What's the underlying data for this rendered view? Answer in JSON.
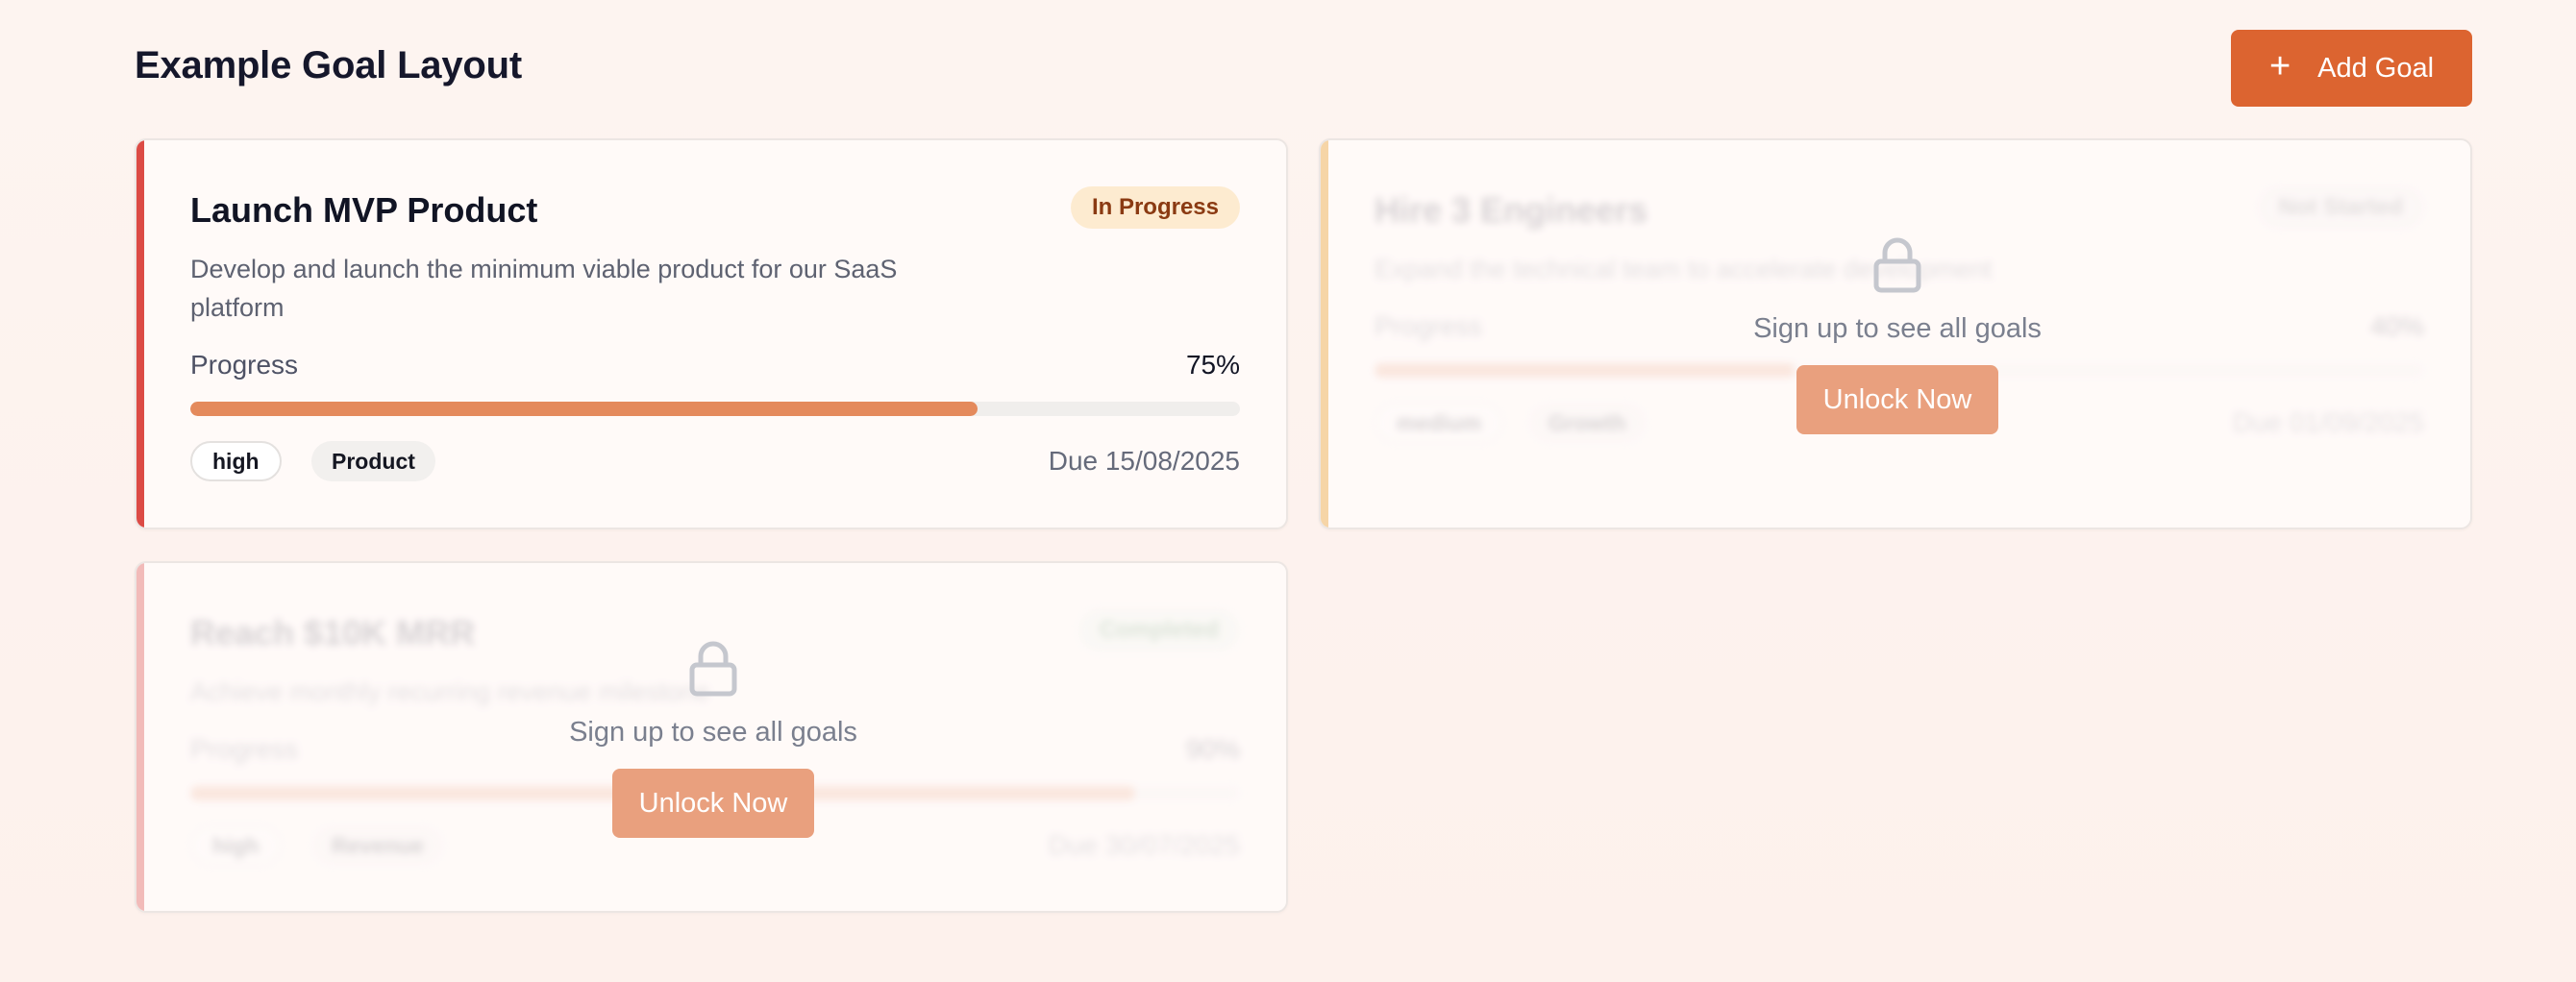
{
  "page": {
    "title": "Example Goal Layout",
    "add_button": {
      "icon": "plus-icon",
      "label": "Add Goal"
    }
  },
  "colors": {
    "primary": "#dc6430",
    "progress_fill": "#e48a5c",
    "accent_red": "#dc4b45",
    "accent_yellow": "#f1c27c",
    "accent_pink": "#ec9a97",
    "badge_in_progress_bg": "#fdebd0",
    "badge_in_progress_text": "#8a3a12"
  },
  "lock": {
    "icon": "lock-icon",
    "message": "Sign up to see all goals",
    "button_label": "Unlock Now"
  },
  "goals": [
    {
      "title": "Launch MVP Product",
      "status": "In Progress",
      "description": "Develop and launch the minimum viable product for our SaaS platform",
      "progress_label": "Progress",
      "progress_text": "75%",
      "progress": 0.75,
      "priority": "high",
      "category": "Product",
      "due": "Due 15/08/2025",
      "locked": false
    },
    {
      "title": "Hire 3 Engineers",
      "status": "Not Started",
      "description": "Expand the technical team to accelerate development",
      "progress_label": "Progress",
      "progress_text": "40%",
      "progress": 0.4,
      "priority": "medium",
      "category": "Growth",
      "due": "Due 01/09/2025",
      "locked": true
    },
    {
      "title": "Reach $10K MRR",
      "status": "Completed",
      "description": "Achieve monthly recurring revenue milestone",
      "progress_label": "Progress",
      "progress_text": "90%",
      "progress": 0.9,
      "priority": "high",
      "category": "Revenue",
      "due": "Due 30/07/2025",
      "locked": true
    }
  ]
}
